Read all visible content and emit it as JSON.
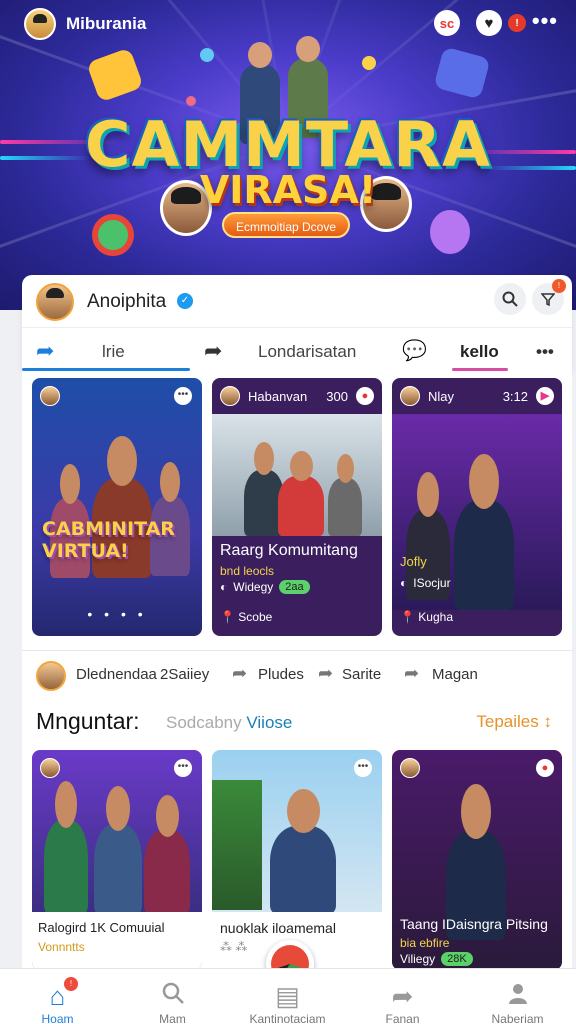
{
  "app": {
    "name": "Miburania",
    "badge_text": "sc",
    "alert_badge": "!"
  },
  "hero": {
    "title": "CAMMTARA",
    "subtitle": "VIRASA!",
    "pill": "Ecmmoitiap Dcove"
  },
  "profile": {
    "name": "Anoiphita",
    "notif_count": "!"
  },
  "tabs": [
    {
      "label": "lrie",
      "icon": "share-arrow-icon",
      "active": true
    },
    {
      "label": "Londarisatan",
      "icon": "forward-arrow-icon",
      "active": false
    },
    {
      "label": "kello",
      "icon": "speech-bubble-icon",
      "active": true
    }
  ],
  "tabs_more": "•••",
  "feed_cards": [
    {
      "title": "CABMINITAR VIRTUA!",
      "menu_icon": "•••",
      "dots": "• • • •"
    },
    {
      "author": "Habanvan",
      "count": "300",
      "title": "Raarg Komumitang",
      "subtitle": "bnd leocls",
      "meta": "Widegy",
      "meta_pill": "2aa",
      "location": "Scobe"
    },
    {
      "author": "Nlay",
      "count": "3:12",
      "title": "Jofly",
      "meta": "ISocjur",
      "location": "Kugha"
    }
  ],
  "action_row": {
    "user": "Dlednendaa",
    "stat": "2Saiiey",
    "actions": [
      "Pludes",
      "Sarite",
      "Magan"
    ]
  },
  "section": {
    "title": "Mnguntar:",
    "sub_muted": "Sodcabny",
    "sub_link": "Viiose",
    "link": "Tepailes ↕"
  },
  "bottom_cards": [
    {
      "title": "Ralogird 1K Comuuial",
      "subtitle": "Vonnntts"
    },
    {
      "title": "nuoklak iloamemal",
      "subtitle": "⁂ ⁂"
    },
    {
      "title": "Taang IDaisngra Pitsing",
      "subtitle": "bia ebfire",
      "meta": "Viliegy",
      "meta_pill": "28K"
    }
  ],
  "nav": [
    {
      "label": "Hoam",
      "icon": "home-icon",
      "active": true,
      "badge": "!"
    },
    {
      "label": "Mam",
      "icon": "search-icon",
      "active": false
    },
    {
      "label": "Kantinotaciam",
      "icon": "inbox-icon",
      "active": false
    },
    {
      "label": "Fanan",
      "icon": "share-icon",
      "active": false
    },
    {
      "label": "Naberiam",
      "icon": "profile-icon",
      "active": false
    }
  ],
  "colors": {
    "accent_blue": "#1d7fd8",
    "accent_pink": "#d84ca0",
    "title_yellow": "#f9d24a"
  }
}
